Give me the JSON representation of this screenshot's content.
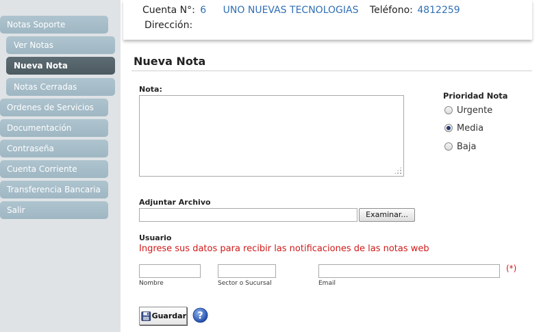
{
  "sidebar": {
    "items": [
      {
        "label": "Notas Soporte",
        "type": "main"
      },
      {
        "label": "Ver Notas",
        "type": "sub"
      },
      {
        "label": "Nueva Nota",
        "type": "sub",
        "active": true
      },
      {
        "label": "Notas Cerradas",
        "type": "sub"
      },
      {
        "label": "Ordenes de Servicios",
        "type": "main"
      },
      {
        "label": "Documentación",
        "type": "main"
      },
      {
        "label": "Contraseña",
        "type": "main"
      },
      {
        "label": "Cuenta Corriente",
        "type": "main"
      },
      {
        "label": "Transferencia Bancaria",
        "type": "main"
      },
      {
        "label": "Salir",
        "type": "main"
      }
    ]
  },
  "header": {
    "account_label": "Cuenta N°:",
    "account_number": "6",
    "company": "UNO NUEVAS TECNOLOGIAS",
    "phone_label": "Teléfono:",
    "phone": "4812259",
    "address_label": "Dirección:",
    "address": ""
  },
  "page": {
    "title": "Nueva Nota"
  },
  "form": {
    "nota_label": "Nota:",
    "nota_value": "",
    "priority": {
      "label": "Prioridad Nota",
      "options": [
        "Urgente",
        "Media",
        "Baja"
      ],
      "selected": "Media"
    },
    "attach_label": "Adjuntar Archivo",
    "attach_value": "",
    "browse_label": "Examinar...",
    "user_label": "Usuario",
    "notice": "Ingrese sus datos para recibir las notificaciones de las notas web",
    "nombre_label": "Nombre",
    "nombre_value": "",
    "sector_label": "Sector o Sucursal",
    "sector_value": "",
    "email_label": "Email",
    "email_value": "",
    "required_mark": "(*)",
    "save_label": "Guardar"
  },
  "colors": {
    "sidebar_bg": "#dfe3e6",
    "nav_item": "#a7bfcb",
    "nav_active": "#55636a",
    "link_blue": "#2f6fb5",
    "alert_red": "#d01818"
  }
}
